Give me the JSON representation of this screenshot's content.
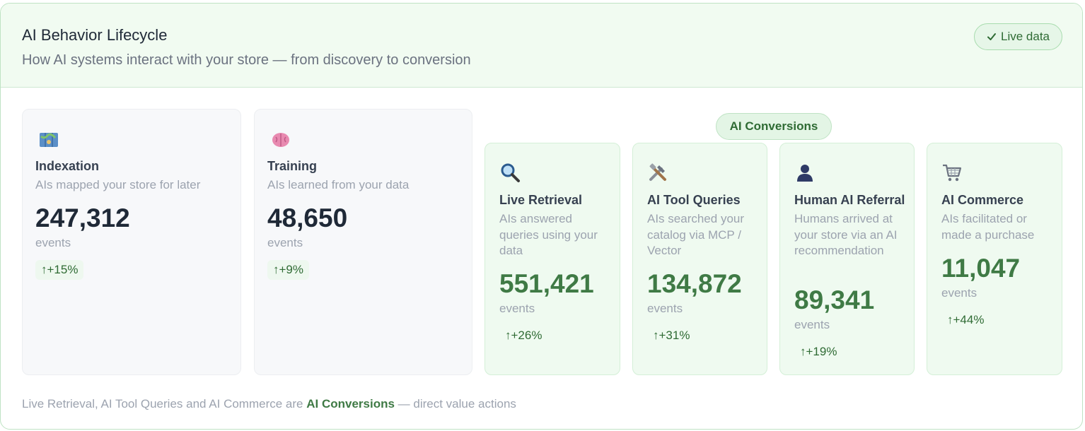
{
  "header": {
    "title": "AI Behavior Lifecycle",
    "subtitle": "How AI systems interact with your store — from discovery to conversion",
    "live_badge": "Live data",
    "live_icon": "check-icon"
  },
  "conversions_badge": "AI Conversions",
  "cards": [
    {
      "icon": "map-icon",
      "title": "Indexation",
      "desc": "AIs mapped your store for later",
      "value": "247,312",
      "unit": "events",
      "delta": "↑+15%"
    },
    {
      "icon": "brain-icon",
      "title": "Training",
      "desc": "AIs learned from your data",
      "value": "48,650",
      "unit": "events",
      "delta": "↑+9%"
    },
    {
      "icon": "magnifier-icon",
      "title": "Live Retrieval",
      "desc": "AIs answered queries using your data",
      "value": "551,421",
      "unit": "events",
      "delta": "↑+26%"
    },
    {
      "icon": "tools-icon",
      "title": "AI Tool Queries",
      "desc": "AIs searched your catalog via MCP / Vector",
      "value": "134,872",
      "unit": "events",
      "delta": "↑+31%"
    },
    {
      "icon": "person-icon",
      "title": "Human AI Referral",
      "desc": "Humans arrived at your store via an AI recommendation",
      "value": "89,341",
      "unit": "events",
      "delta": "↑+19%"
    },
    {
      "icon": "cart-icon",
      "title": "AI Commerce",
      "desc": "AIs facilitated or made a purchase",
      "value": "11,047",
      "unit": "events",
      "delta": "↑+44%"
    }
  ],
  "footer": {
    "prefix": "Live Retrieval, AI Tool Queries and AI Commerce are",
    "highlight": "AI Conversions",
    "suffix": "— direct value actions"
  },
  "colors": {
    "accent_green": "#3f7a45",
    "header_bg": "#f1fbf1",
    "conversion_card_bg": "#effaf0",
    "neutral_card_bg": "#f7f8fa"
  }
}
